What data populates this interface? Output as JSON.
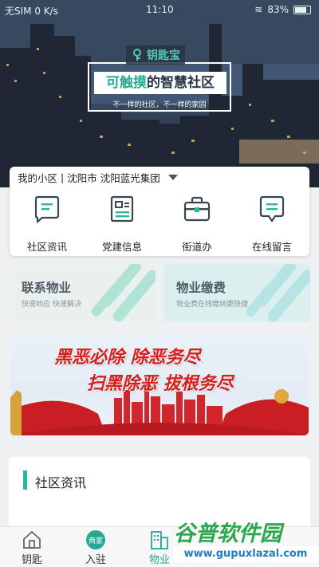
{
  "status_bar": {
    "left": "无SIM 0 K/s",
    "time": "11:10",
    "battery": "83%"
  },
  "hero": {
    "brand": "钥匙宝",
    "slogan_accent": "可触摸",
    "slogan_rest": "的智慧社区",
    "subtitle": "不一样的社区，不一样的家园"
  },
  "community": {
    "label": "我的小区",
    "separator": "|",
    "city": "沈阳市",
    "name": "沈阳蓝光集团"
  },
  "quick_actions": [
    {
      "label": "社区资讯",
      "icon": "news-icon"
    },
    {
      "label": "党建信息",
      "icon": "document-icon"
    },
    {
      "label": "街道办",
      "icon": "briefcase-icon"
    },
    {
      "label": "在线留言",
      "icon": "message-icon"
    }
  ],
  "services": [
    {
      "title": "联系物业",
      "subtitle": "快速响应 快速解决"
    },
    {
      "title": "物业缴费",
      "subtitle": "物业费在线缴纳更快捷"
    }
  ],
  "banner": {
    "line1": "黑恶必除  除恶务尽",
    "line2": "扫黑除恶  拔根务尽"
  },
  "news": {
    "title": "社区资讯"
  },
  "nav": [
    {
      "label": "钥匙",
      "icon": "home-icon"
    },
    {
      "label": "入驻",
      "icon": "merchant-icon",
      "badge": "商家"
    },
    {
      "label": "物业",
      "icon": "building-icon",
      "active": true
    }
  ],
  "watermark": {
    "title": "谷普软件园",
    "url": "www.gupuxlazal.com"
  },
  "colors": {
    "accent": "#28b9a0",
    "banner_red": "#d41f1f"
  }
}
